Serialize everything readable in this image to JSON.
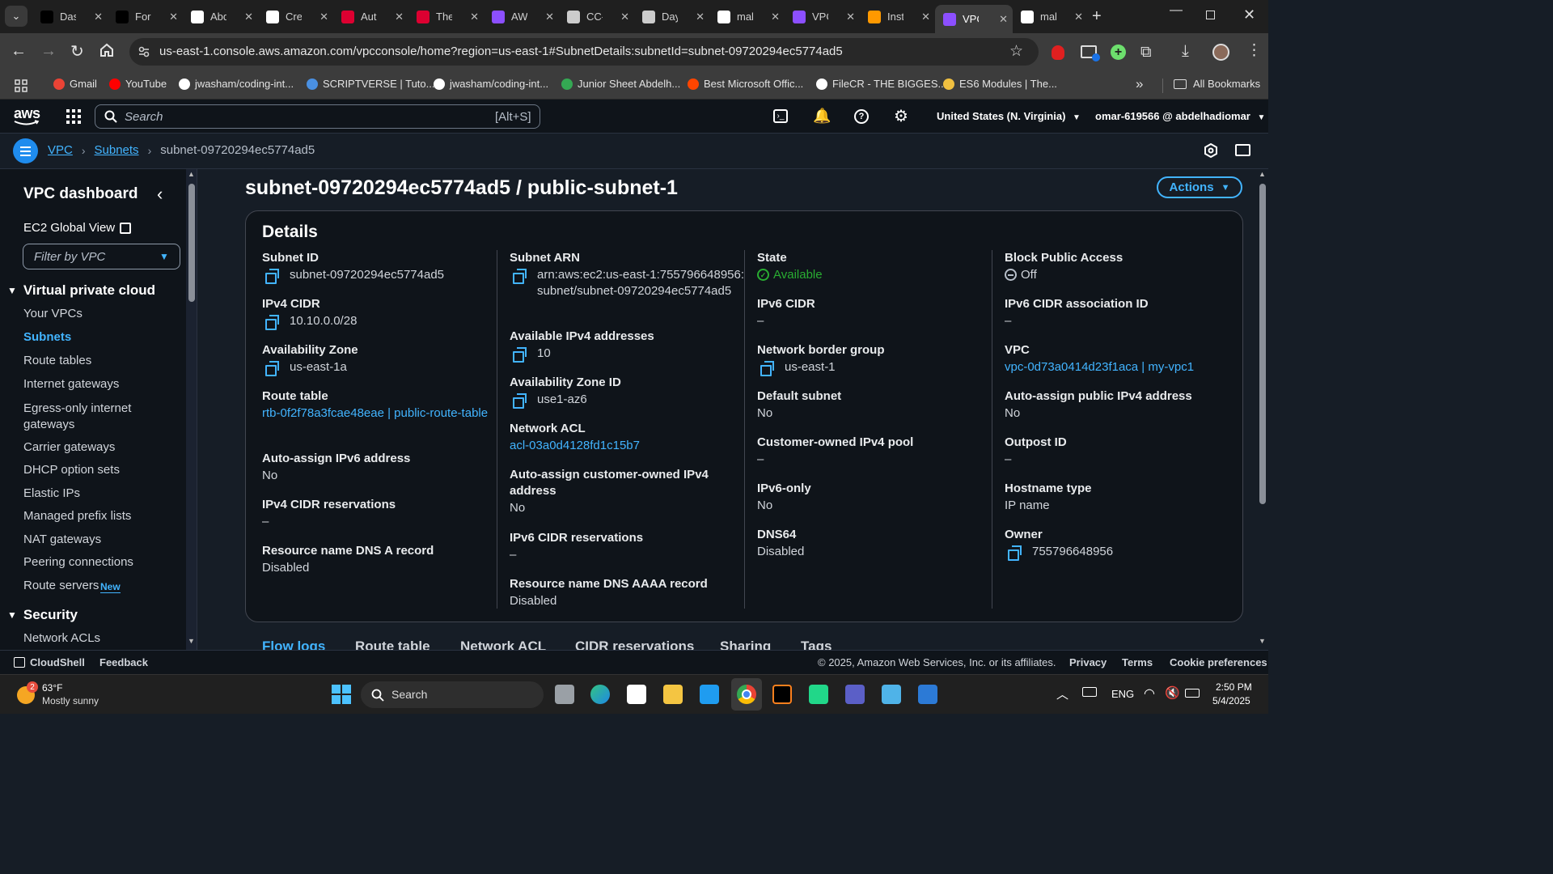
{
  "browser": {
    "tabs": [
      {
        "label": "Dasl",
        "icon": "dashboard-favicon",
        "color": "#000000"
      },
      {
        "label": "Forr",
        "icon": "forms-favicon",
        "color": "#000000"
      },
      {
        "label": "Abd",
        "icon": "github-favicon",
        "color": "#ffffff"
      },
      {
        "label": "Cre",
        "icon": "openai-favicon",
        "color": "#ffffff"
      },
      {
        "label": "Aut",
        "icon": "angular-favicon",
        "color": "#dd0031"
      },
      {
        "label": "The",
        "icon": "angular-favicon",
        "color": "#dd0031"
      },
      {
        "label": "AW",
        "icon": "cube-favicon",
        "color": "#8c4fff"
      },
      {
        "label": "CC-",
        "icon": "globe-favicon",
        "color": "#cccccc"
      },
      {
        "label": "Day",
        "icon": "globe-favicon",
        "color": "#cccccc"
      },
      {
        "label": "mal",
        "icon": "github-favicon",
        "color": "#ffffff"
      },
      {
        "label": "VPC",
        "icon": "vpc-favicon",
        "color": "#8c4fff"
      },
      {
        "label": "Inst",
        "icon": "ec2-favicon",
        "color": "#ff9900"
      },
      {
        "label": "VPC",
        "icon": "vpc-favicon",
        "color": "#8c4fff"
      },
      {
        "label": "mal",
        "icon": "github-favicon",
        "color": "#ffffff"
      }
    ],
    "active_tab_index": 12,
    "url": "us-east-1.console.aws.amazon.com/vpcconsole/home?region=us-east-1#SubnetDetails:subnetId=subnet-09720294ec5774ad5",
    "bookmarks": [
      {
        "label": "Gmail",
        "color": "#ea4335"
      },
      {
        "label": "YouTube",
        "color": "#ff0000"
      },
      {
        "label": "jwasham/coding-int...",
        "color": "#ffffff"
      },
      {
        "label": "SCRIPTVERSE | Tuto...",
        "color": "#4a90e2"
      },
      {
        "label": "jwasham/coding-int...",
        "color": "#ffffff"
      },
      {
        "label": "Junior Sheet Abdelh...",
        "color": "#34a853"
      },
      {
        "label": "Best Microsoft Offic...",
        "color": "#ff4500"
      },
      {
        "label": "FileCR - THE BIGGES...",
        "color": "#ffffff"
      },
      {
        "label": "ES6 Modules | The...",
        "color": "#f0c040"
      }
    ],
    "all_bookmarks": "All Bookmarks",
    "more": "»"
  },
  "aws": {
    "logo": "aws",
    "search_placeholder": "Search",
    "search_shortcut": "[Alt+S]",
    "region": "United States (N. Virginia)",
    "account": "omar-619566 @ abdelhadiomar",
    "breadcrumbs": [
      "VPC",
      "Subnets",
      "subnet-09720294ec5774ad5"
    ]
  },
  "sidebar": {
    "title": "VPC dashboard",
    "ec2_global": "EC2 Global View",
    "filter_placeholder": "Filter by VPC",
    "section_vpc": "Virtual private cloud",
    "items": [
      "Your VPCs",
      "Subnets",
      "Route tables",
      "Internet gateways",
      "Egress-only internet gateways",
      "Carrier gateways",
      "DHCP option sets",
      "Elastic IPs",
      "Managed prefix lists",
      "NAT gateways",
      "Peering connections",
      "Route servers"
    ],
    "new_badge": "New",
    "section_security": "Security",
    "security_items": [
      "Network ACLs"
    ]
  },
  "page": {
    "title": "subnet-09720294ec5774ad5 / public-subnet-1",
    "actions": "Actions",
    "details_heading": "Details",
    "col1": [
      {
        "label": "Subnet ID",
        "value": "subnet-09720294ec5774ad5",
        "copy": true
      },
      {
        "label": "IPv4 CIDR",
        "value": "10.10.0.0/28",
        "copy": true
      },
      {
        "label": "Availability Zone",
        "value": "us-east-1a",
        "copy": true
      },
      {
        "label": "Route table",
        "value": "rtb-0f2f78a3fcae48eae | public-route-table",
        "link": true
      },
      {
        "label": "Auto-assign IPv6 address",
        "value": "No"
      },
      {
        "label": "IPv4 CIDR reservations",
        "value": "–"
      },
      {
        "label": "Resource name DNS A record",
        "value": "Disabled"
      }
    ],
    "col2": [
      {
        "label": "Subnet ARN",
        "value": "arn:aws:ec2:us-east-1:755796648956:subnet/subnet-09720294ec5774ad5",
        "copy": true
      },
      {
        "label": "Available IPv4 addresses",
        "value": "10",
        "copy": true
      },
      {
        "label": "Availability Zone ID",
        "value": "use1-az6",
        "copy": true
      },
      {
        "label": "Network ACL",
        "value": "acl-03a0d4128fd1c15b7",
        "link": true
      },
      {
        "label": "Auto-assign customer-owned IPv4 address",
        "value": "No"
      },
      {
        "label": "IPv6 CIDR reservations",
        "value": "–"
      },
      {
        "label": "Resource name DNS AAAA record",
        "value": "Disabled"
      }
    ],
    "col3": [
      {
        "label": "State",
        "value": "Available",
        "status": "success"
      },
      {
        "label": "IPv6 CIDR",
        "value": "–"
      },
      {
        "label": "Network border group",
        "value": "us-east-1",
        "copy": true
      },
      {
        "label": "Default subnet",
        "value": "No"
      },
      {
        "label": "Customer-owned IPv4 pool",
        "value": "–"
      },
      {
        "label": "IPv6-only",
        "value": "No"
      },
      {
        "label": "DNS64",
        "value": "Disabled"
      }
    ],
    "col4": [
      {
        "label": "Block Public Access",
        "value": "Off",
        "status": "off"
      },
      {
        "label": "IPv6 CIDR association ID",
        "value": "–"
      },
      {
        "label": "VPC",
        "value": "vpc-0d73a0414d23f1aca | my-vpc1",
        "link": true
      },
      {
        "label": "Auto-assign public IPv4 address",
        "value": "No"
      },
      {
        "label": "Outpost ID",
        "value": "–"
      },
      {
        "label": "Hostname type",
        "value": "IP name"
      },
      {
        "label": "Owner",
        "value": "755796648956",
        "copy": true
      }
    ],
    "tabs": [
      "Flow logs",
      "Route table",
      "Network ACL",
      "CIDR reservations",
      "Sharing",
      "Tags"
    ]
  },
  "footer": {
    "cloudshell": "CloudShell",
    "feedback": "Feedback",
    "copyright": "© 2025, Amazon Web Services, Inc. or its affiliates.",
    "privacy": "Privacy",
    "terms": "Terms",
    "cookie": "Cookie preferences"
  },
  "taskbar": {
    "weather_temp": "63°F",
    "weather_desc": "Mostly sunny",
    "weather_badge": "2",
    "search": "Search",
    "lang": "ENG",
    "time": "2:50 PM",
    "date": "5/4/2025"
  }
}
